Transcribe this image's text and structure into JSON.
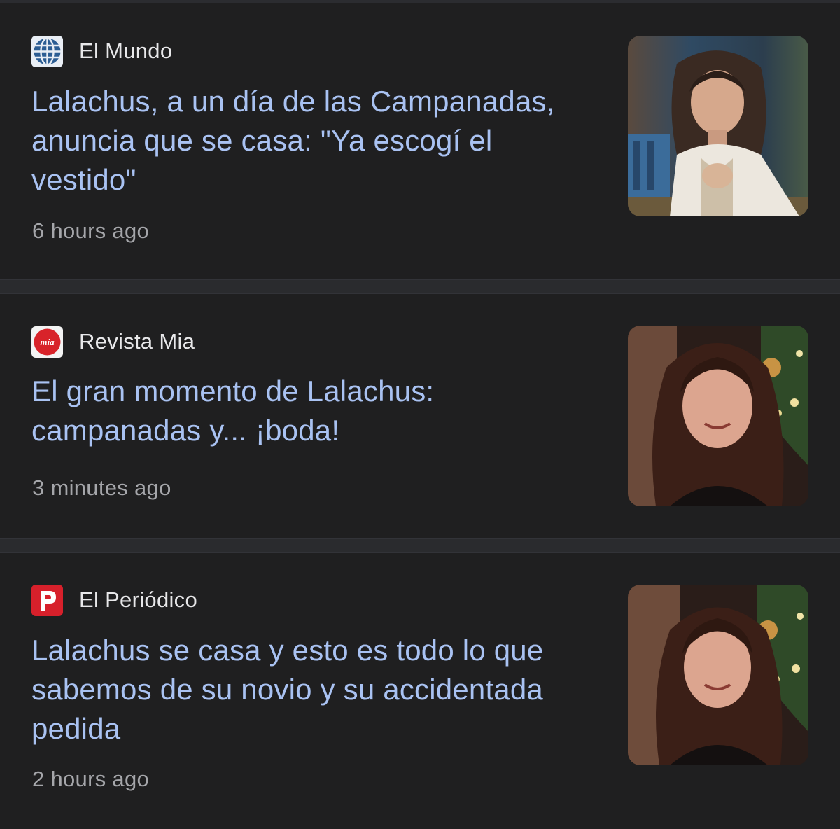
{
  "articles": [
    {
      "source": "El Mundo",
      "source_logo_icon": "el-mundo-globe-icon",
      "headline": "Lalachus, a un día de las Campanadas, anuncia que se casa: \"Ya escogí el vestido\"",
      "time": "6 hours ago",
      "thumbnail": "woman-white-blouse-photo"
    },
    {
      "source": "Revista Mia",
      "source_logo_icon": "revista-mia-logo-icon",
      "headline": "El gran momento de Lalachus: campanadas y... ¡boda!",
      "time": "3 minutes ago",
      "thumbnail": "woman-portrait-christmas-tree-photo"
    },
    {
      "source": "El Periódico",
      "source_logo_icon": "el-periodico-p-icon",
      "headline": "Lalachus se casa y esto es todo lo que sabemos de su novio y su accidentada pedida",
      "time": "2 hours ago",
      "thumbnail": "woman-portrait-christmas-tree-photo"
    }
  ],
  "colors": {
    "background": "#1f1f20",
    "headline": "#a9c2f2",
    "source": "#e8e8ea",
    "time": "#a5a6aa",
    "separator": "#2a2b2e"
  }
}
